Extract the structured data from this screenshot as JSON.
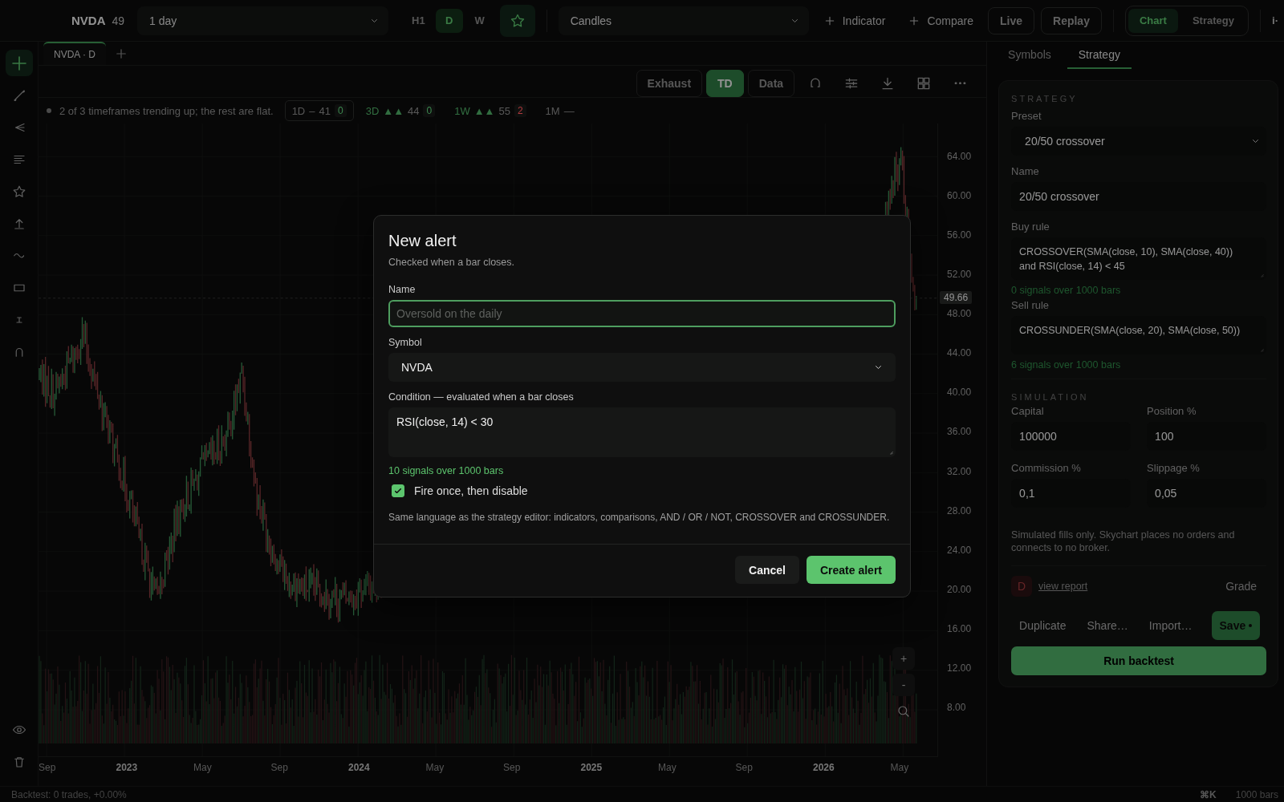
{
  "top_bar": {
    "symbol": "NVDA",
    "price": "49",
    "interval": "1 day",
    "timeframes": [
      {
        "label": "H1",
        "selected": false
      },
      {
        "label": "D",
        "selected": true
      },
      {
        "label": "W",
        "selected": false
      }
    ],
    "watchlist_star": {
      "on": true
    },
    "chart_style": "Candles",
    "actions": [
      {
        "label": "Indicator"
      },
      {
        "label": "Compare"
      }
    ],
    "modes": [
      {
        "label": "Live"
      },
      {
        "label": "Replay"
      }
    ],
    "views": [
      {
        "label": "Chart",
        "selected": true
      },
      {
        "label": "Strategy",
        "selected": false
      }
    ],
    "overflow_label": "i·"
  },
  "drawing_tools": [
    {
      "kind": "crosshair",
      "selected": true
    },
    {
      "kind": "line",
      "selected": false
    },
    {
      "kind": "fork",
      "selected": false
    },
    {
      "kind": "text",
      "selected": false
    },
    {
      "kind": "star",
      "selected": false
    },
    {
      "kind": "upload",
      "selected": false
    },
    {
      "kind": "wave",
      "selected": false
    },
    {
      "kind": "rectangle",
      "selected": false
    },
    {
      "kind": "measure",
      "selected": false
    },
    {
      "kind": "magnet",
      "selected": false
    }
  ],
  "bottom_tools": [
    {
      "kind": "eye"
    },
    {
      "kind": "trash"
    }
  ],
  "chart_tabs": [
    {
      "label": "NVDA · D",
      "selected": true
    }
  ],
  "chart_toolbar": {
    "toggles": [
      {
        "label": "Exhaust",
        "on": false
      },
      {
        "label": "TD",
        "on": true
      },
      {
        "label": "Data",
        "on": false
      }
    ]
  },
  "trend": {
    "summary": "2 of 3 timeframes trending up; the rest are flat.",
    "frames": [
      {
        "label": "1D",
        "kind": "flat",
        "arrows": "–",
        "value": "41",
        "count": "0",
        "color": "#3d8a50",
        "selected": true
      },
      {
        "label": "3D",
        "kind": "up",
        "arrows": "▲▲",
        "value": "44",
        "count": "0",
        "color": "#3d8a50",
        "selected": false
      },
      {
        "label": "1W",
        "kind": "up",
        "arrows": "▲▲",
        "value": "55",
        "count": "2",
        "color": "#b03a3e",
        "selected": false
      },
      {
        "label": "1M",
        "kind": "none",
        "arrows": "—",
        "selected": false
      }
    ]
  },
  "chart": {
    "price_labels": [
      "64.00",
      "60.00",
      "56.00",
      "52.00",
      "48.00",
      "44.00",
      "40.00",
      "36.00",
      "32.00",
      "28.00",
      "24.00",
      "20.00",
      "16.00",
      "12.00",
      "8.00"
    ],
    "last_price": "49.66",
    "time_labels": [
      {
        "label": "Sep",
        "major": false
      },
      {
        "label": "2023",
        "major": true
      },
      {
        "label": "May",
        "major": false
      },
      {
        "label": "Sep",
        "major": false
      },
      {
        "label": "2024",
        "major": true
      },
      {
        "label": "May",
        "major": false
      },
      {
        "label": "Sep",
        "major": false
      },
      {
        "label": "2025",
        "major": true
      },
      {
        "label": "May",
        "major": false
      },
      {
        "label": "Sep",
        "major": false
      },
      {
        "label": "2026",
        "major": true
      },
      {
        "label": "May",
        "major": false
      }
    ],
    "zoom_controls": [
      "+",
      "-"
    ]
  },
  "side_panel": {
    "tabs": [
      {
        "label": "Symbols",
        "selected": false
      },
      {
        "label": "Strategy",
        "selected": true
      }
    ],
    "strategy": {
      "heading": "STRATEGY",
      "preset": {
        "label": "Preset",
        "value": "20/50 crossover"
      },
      "name": {
        "label": "Name",
        "value": "20/50 crossover"
      },
      "rules": [
        {
          "label": "Buy rule",
          "value": "CROSSOVER(SMA(close, 10), SMA(close, 40)) and RSI(close, 14) < 45",
          "signals": "0 signals over 1000 bars"
        },
        {
          "label": "Sell rule",
          "value": "CROSSUNDER(SMA(close, 20), SMA(close, 50))",
          "signals": "6 signals over 1000 bars"
        }
      ],
      "simulation": {
        "heading": "SIMULATION",
        "fields": [
          {
            "label": "Capital",
            "value": "100000"
          },
          {
            "label": "Position %",
            "value": "100"
          },
          {
            "label": "Commission %",
            "value": "0,1"
          },
          {
            "label": "Slippage %",
            "value": "0,05"
          }
        ]
      },
      "disclaimer": "Simulated fills only. Skychart places no orders and connects to no broker.",
      "grade": {
        "letter": "D",
        "link": "view report",
        "label": "Grade"
      },
      "actions": [
        {
          "label": "Duplicate",
          "kind": "plain"
        },
        {
          "label": "Share…",
          "kind": "plain"
        },
        {
          "label": "Import…",
          "kind": "plain"
        },
        {
          "label": "Save",
          "kind": "primary",
          "unsaved": true
        }
      ],
      "run_button": "Run backtest"
    }
  },
  "status_bar": {
    "backtest": "Backtest: 0 trades, +0.00%",
    "shortcut": "⌘K",
    "bars": "1000 bars"
  },
  "alert_dialog": {
    "title": "New alert",
    "subtitle": "Checked when a bar closes.",
    "name": {
      "label": "Name",
      "placeholder": "Oversold on the daily"
    },
    "symbol": {
      "label": "Symbol",
      "value": "NVDA"
    },
    "condition": {
      "label": "Condition — evaluated when a bar closes",
      "value": "RSI(close, 14) < 30"
    },
    "signals": "10 signals over 1000 bars",
    "fire_once": {
      "label": "Fire once, then disable",
      "checked": true
    },
    "help": "Same language as the strategy editor: indicators, comparisons, AND / OR / NOT, CROSSOVER and CROSSUNDER.",
    "buttons": [
      {
        "label": "Cancel",
        "kind": "secondary"
      },
      {
        "label": "Create alert",
        "kind": "primary"
      }
    ]
  }
}
